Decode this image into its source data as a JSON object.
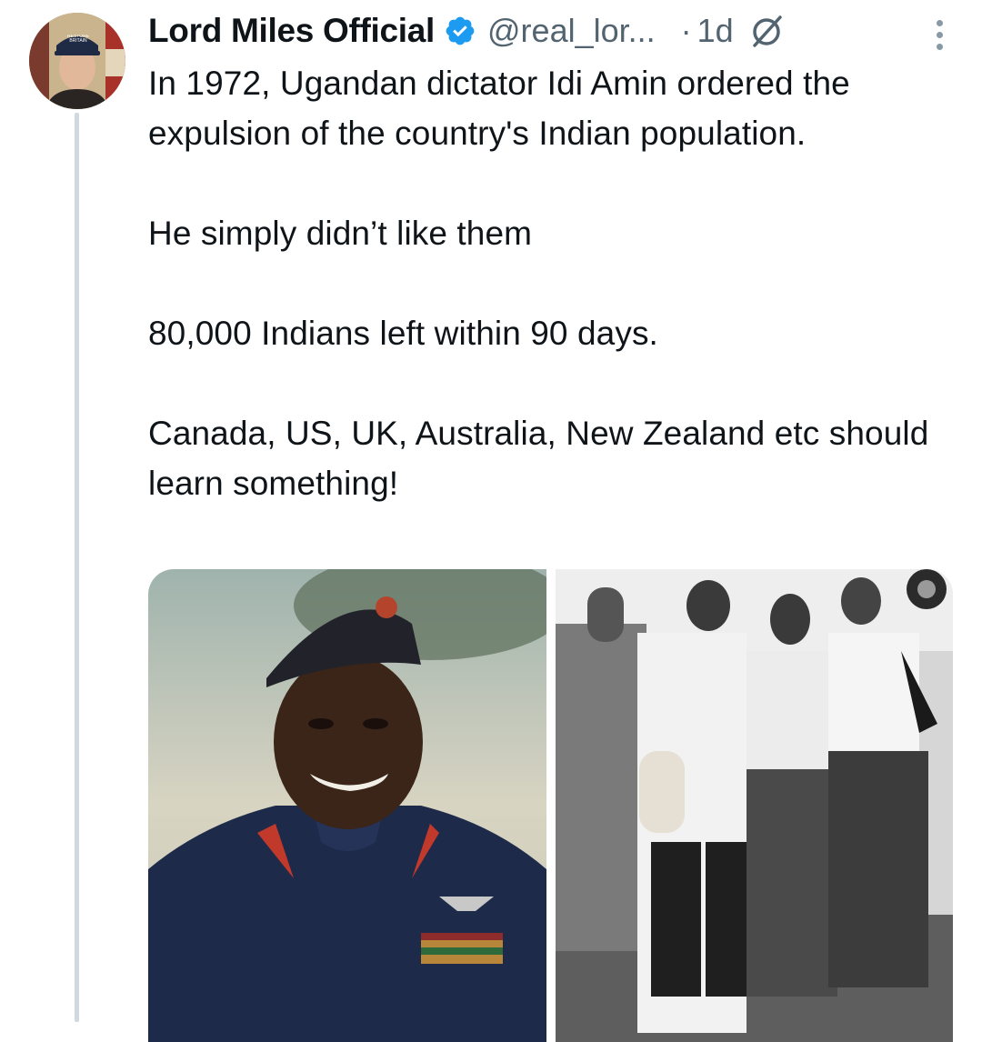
{
  "author": {
    "name": "Lord Miles Official",
    "handle": "@real_lor...",
    "timestamp": "1d",
    "separator": "·",
    "avatar_cap_text": "RESTORE BRITAIN"
  },
  "icons": {
    "verified": "verified-badge-icon",
    "grok": "grok-icon",
    "more": "more-options-icon"
  },
  "tweet": {
    "paragraphs": [
      "In 1972, Ugandan dictator Idi Amin ordered the expulsion of the country's Indian population.",
      "He simply didn’t like them",
      "80,000 Indians left within 90 days.",
      "Canada, US, UK, Australia, New Zealand etc should learn something!"
    ]
  },
  "colors": {
    "text": "#0f1419",
    "muted": "#536471",
    "verified": "#1d9bf0",
    "thread_line": "#cfd9de"
  }
}
